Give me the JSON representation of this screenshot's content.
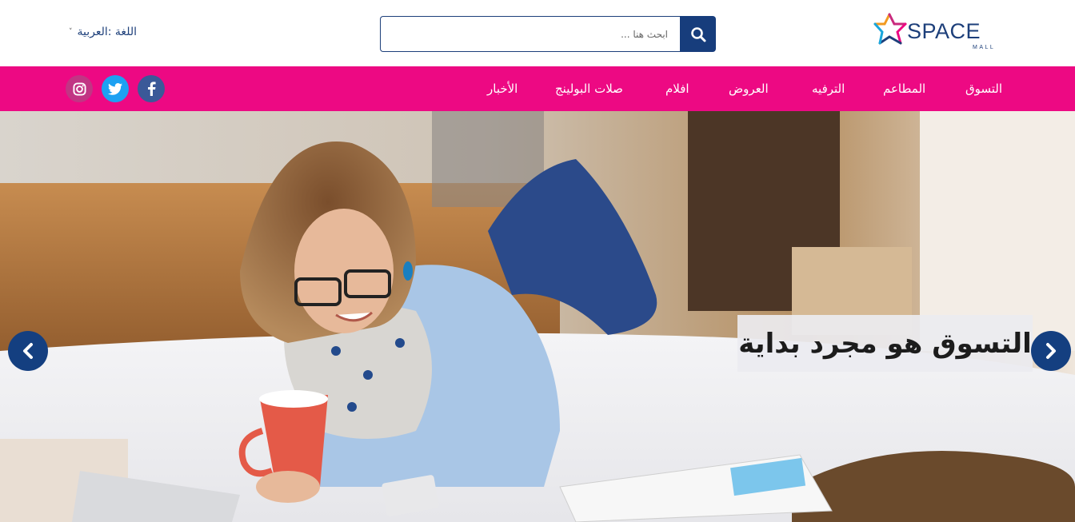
{
  "header": {
    "logo": {
      "word": "SPACE",
      "sub": "MALL"
    },
    "search": {
      "placeholder": "ابحث هنا ...",
      "value": ""
    },
    "language": {
      "label": "اللغة :العربية",
      "caret": "˅"
    }
  },
  "nav": {
    "items": [
      {
        "label": "التسوق"
      },
      {
        "label": "المطاعم"
      },
      {
        "label": "الترفيه"
      },
      {
        "label": "العروض"
      },
      {
        "label": "افلام"
      },
      {
        "label": "صلات البولينج"
      },
      {
        "label": "الأخبار"
      }
    ],
    "social": [
      {
        "icon": "facebook-icon",
        "color": "#3b5998"
      },
      {
        "icon": "twitter-icon",
        "color": "#1da1f2"
      },
      {
        "icon": "instagram-icon",
        "color": "#c13584"
      }
    ]
  },
  "hero": {
    "caption": "التسوق هو مجرد بداية",
    "prev_icon": "chevron-left-icon",
    "next_icon": "chevron-right-icon"
  },
  "colors": {
    "brand_blue": "#173d7c",
    "nav_pink": "#ed0983",
    "arrow_blue": "#143f80"
  }
}
